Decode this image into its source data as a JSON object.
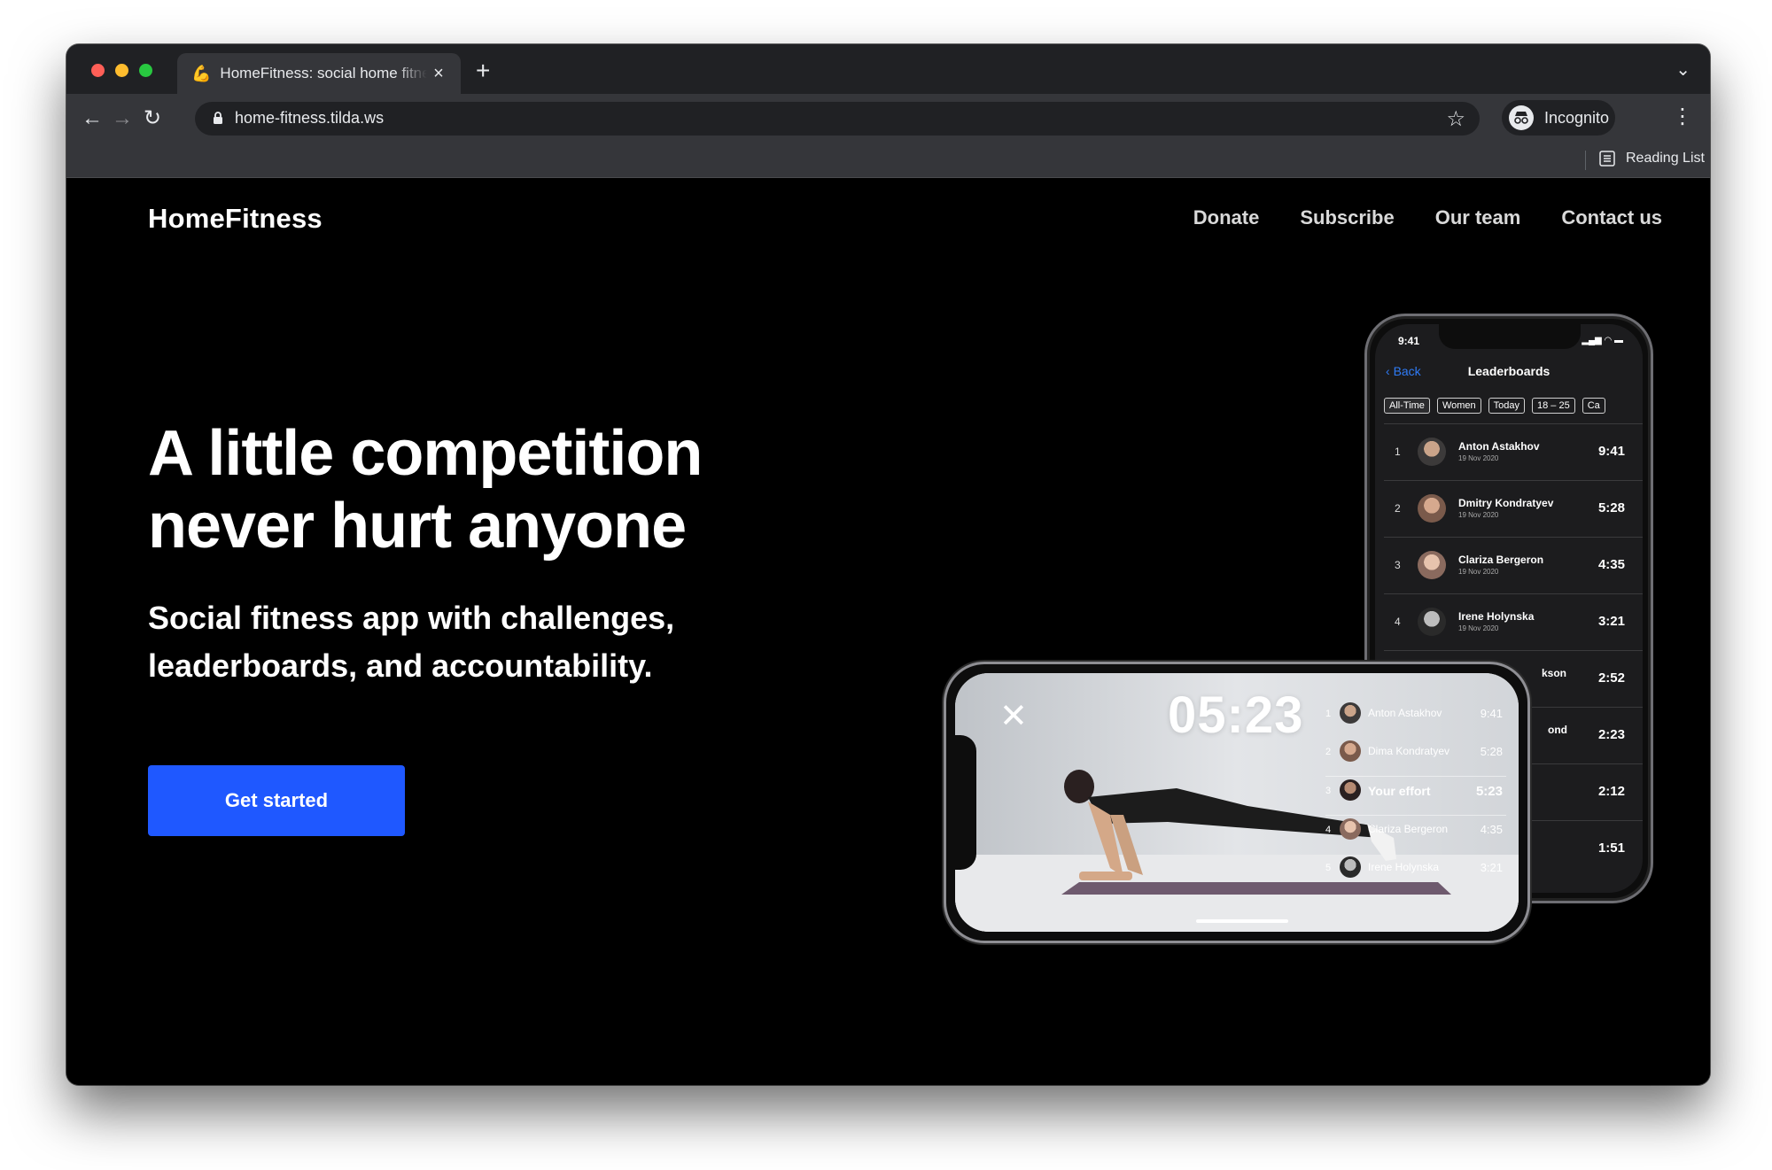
{
  "browser": {
    "tab_title": "HomeFitness: social home fitness",
    "tab_favicon": "flexed-biceps-icon",
    "new_tab": "+",
    "url": "home-fitness.tilda.ws",
    "incognito_label": "Incognito",
    "reading_list_label": "Reading List"
  },
  "site": {
    "brand": "HomeFitness",
    "nav": [
      "Donate",
      "Subscribe",
      "Our team",
      "Contact us"
    ]
  },
  "hero": {
    "headline_line1": "A little competition",
    "headline_line2": "never hurt anyone",
    "subhead_line1": "Social fitness app with challenges,",
    "subhead_line2": "leaderboards, and accountability.",
    "cta": "Get started"
  },
  "leaderboard_phone": {
    "status_time": "9:41",
    "back_label": "Back",
    "title": "Leaderboards",
    "filters": [
      "All-Time",
      "Women",
      "Today",
      "18 – 25",
      "Ca"
    ],
    "rows": [
      {
        "rank": "1",
        "name": "Anton Astakhov",
        "date": "19 Nov 2020",
        "time": "9:41"
      },
      {
        "rank": "2",
        "name": "Dmitry Kondratyev",
        "date": "19 Nov 2020",
        "time": "5:28"
      },
      {
        "rank": "3",
        "name": "Clariza Bergeron",
        "date": "19 Nov 2020",
        "time": "4:35"
      },
      {
        "rank": "4",
        "name": "Irene Holynska",
        "date": "19 Nov 2020",
        "time": "3:21"
      },
      {
        "rank": "",
        "name": "kson",
        "date": "",
        "time": "2:52"
      },
      {
        "rank": "",
        "name": "ond",
        "date": "",
        "time": "2:23"
      },
      {
        "rank": "",
        "name": "",
        "date": "",
        "time": "2:12"
      },
      {
        "rank": "",
        "name": "",
        "date": "",
        "time": "1:51"
      }
    ]
  },
  "workout_phone": {
    "timer": "05:23",
    "rows": [
      {
        "rank": "1",
        "name": "Anton Astakhov",
        "time": "9:41"
      },
      {
        "rank": "2",
        "name": "Dima Kondratyev",
        "time": "5:28"
      },
      {
        "rank": "3",
        "name": "Your effort",
        "time": "5:23"
      },
      {
        "rank": "4",
        "name": "Clariza Bergeron",
        "time": "4:35"
      },
      {
        "rank": "5",
        "name": "Irene Holynska",
        "time": "3:21"
      }
    ]
  },
  "colors": {
    "cta": "#1f58ff",
    "page_bg": "#000000",
    "accent_link": "#2f7bf6"
  }
}
